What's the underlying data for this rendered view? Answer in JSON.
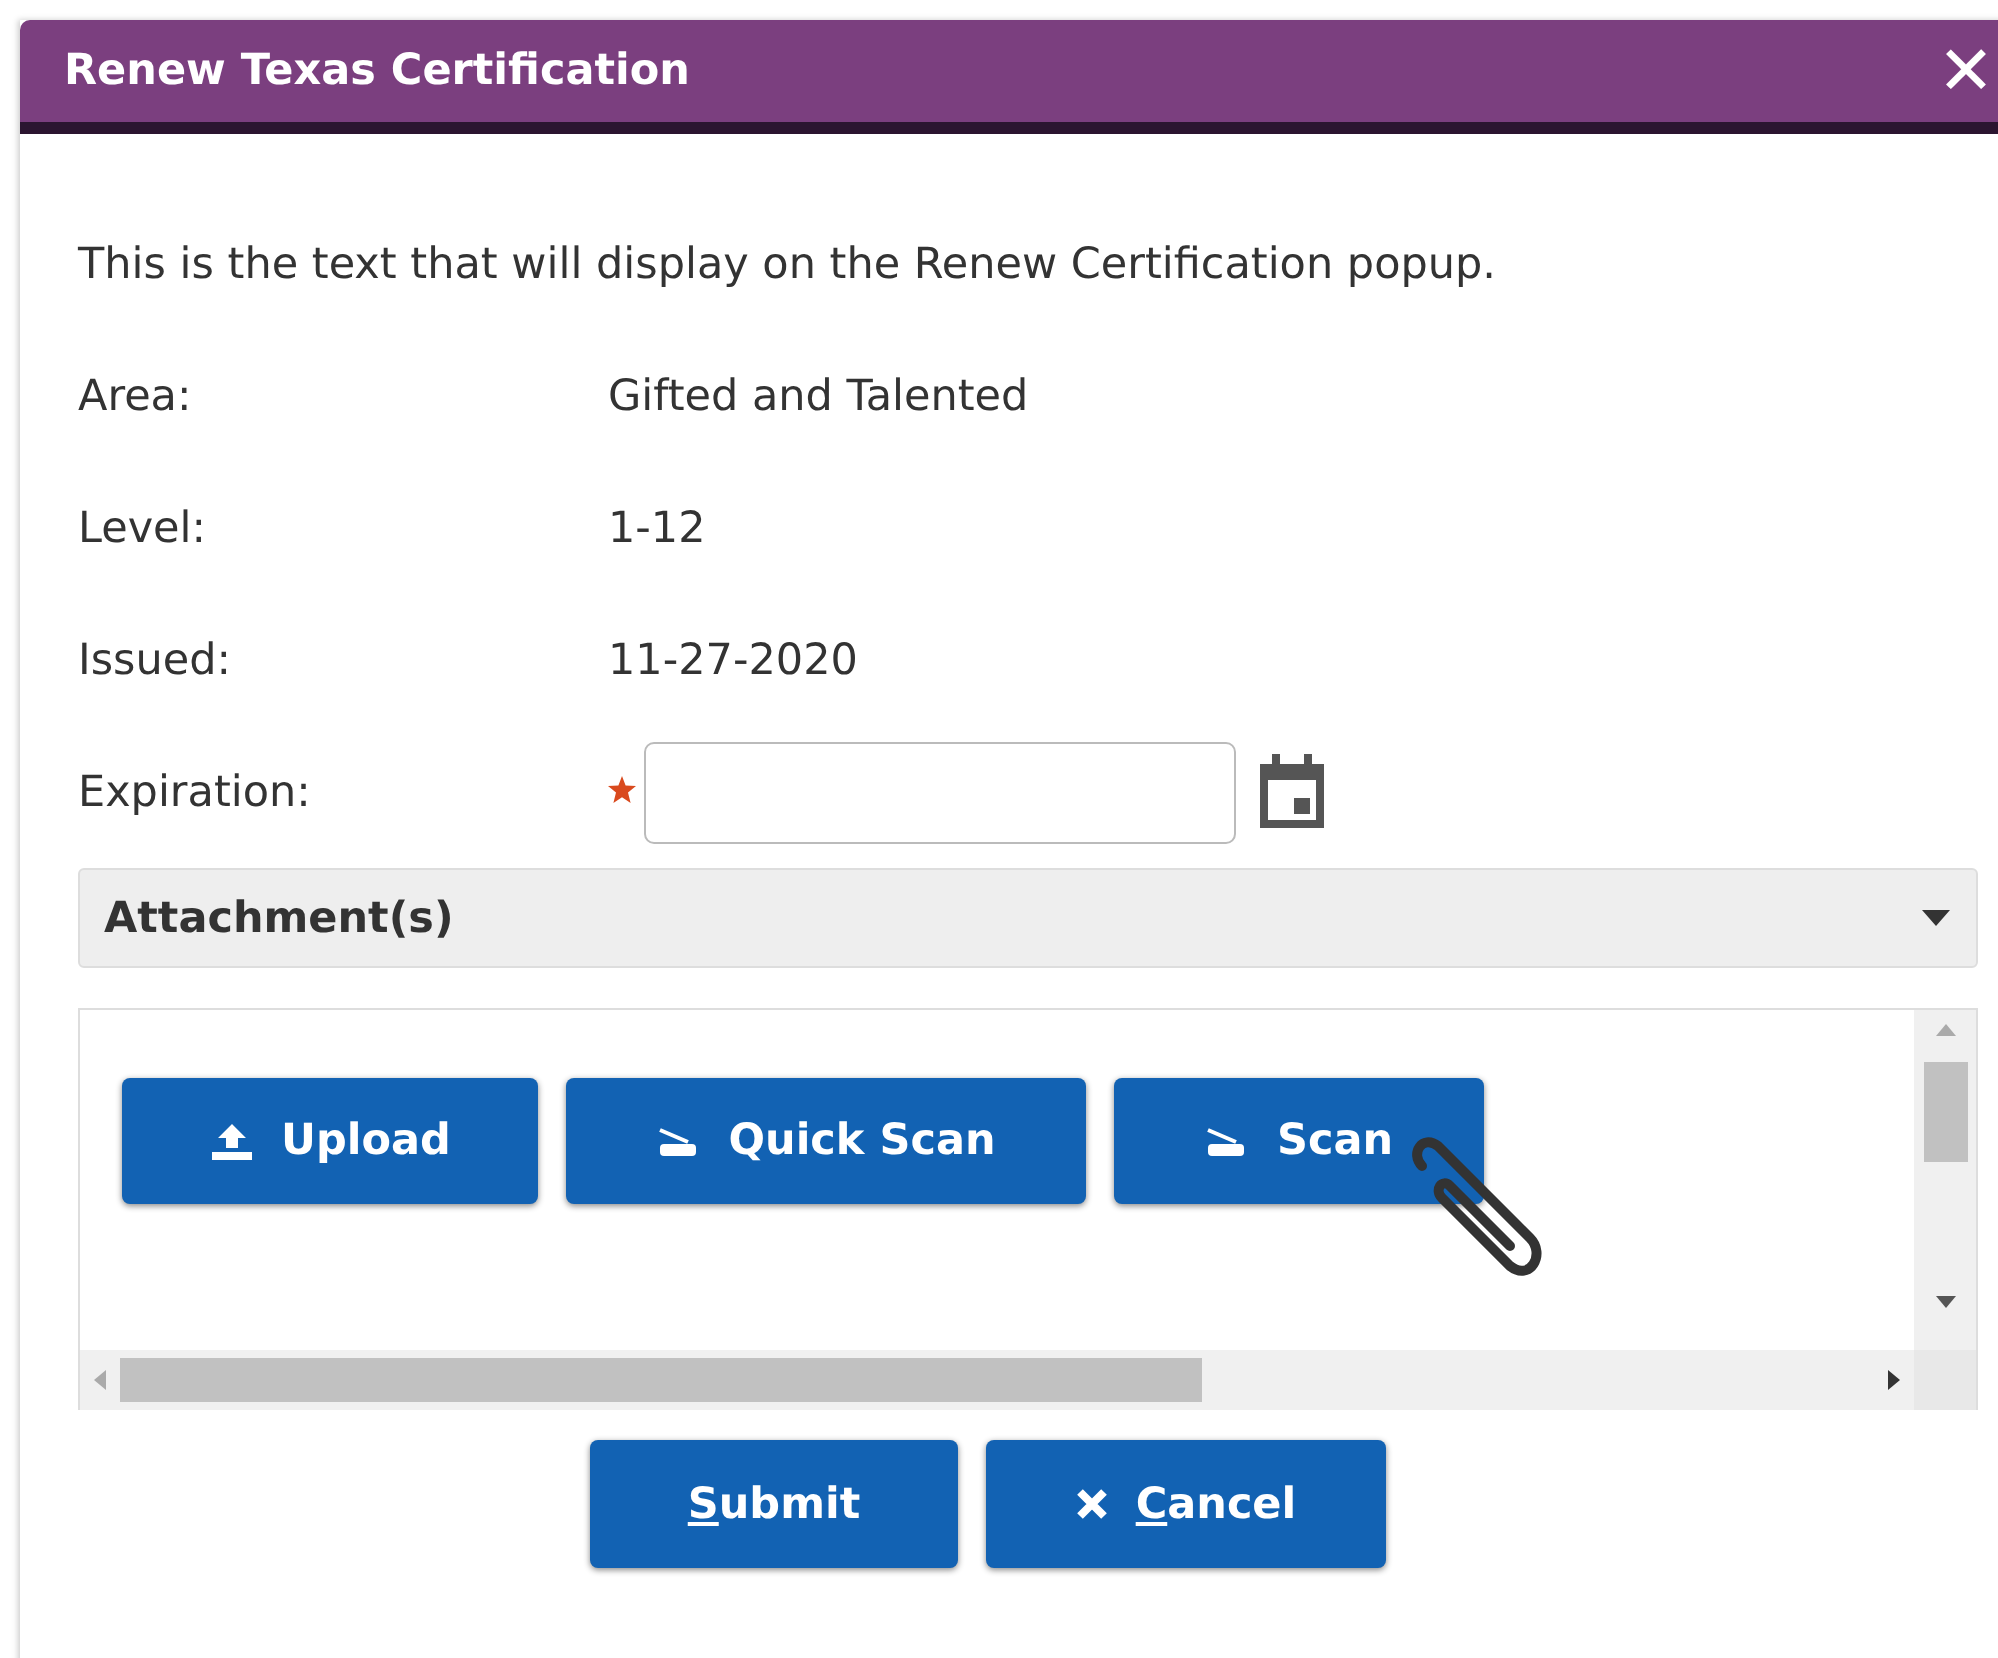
{
  "window": {
    "title": "Renew Texas Certification",
    "close": "✕"
  },
  "intro": "This is the text that will display on the Renew Certification popup.",
  "fields": [
    {
      "kind": "text",
      "label": "Area:",
      "value": "Gifted and Talented"
    },
    {
      "kind": "text",
      "label": "Level:",
      "value": "1-12"
    },
    {
      "kind": "text",
      "label": "Issued:",
      "value": "11-27-2020"
    },
    {
      "kind": "date",
      "label": "Expiration:",
      "required": true
    }
  ],
  "attachments": {
    "title": "Attachment(s)",
    "expanded": true,
    "buttons": [
      {
        "kind": "upload",
        "label": "Upload"
      },
      {
        "kind": "scan",
        "label": "Quick Scan"
      },
      {
        "kind": "scan",
        "label": "Scan"
      }
    ]
  },
  "actions": [
    {
      "kind": "submit",
      "label": "Submit",
      "underline_first": true
    },
    {
      "kind": "cancel",
      "label": "Cancel",
      "underline_first": true
    }
  ]
}
